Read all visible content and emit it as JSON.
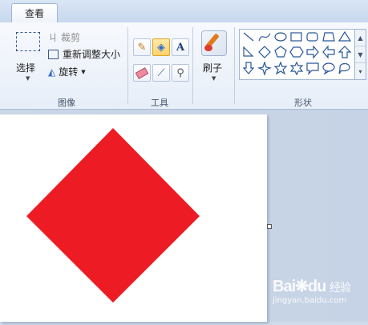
{
  "tabs": {
    "view": "查看"
  },
  "image_group": {
    "label": "图像",
    "select_label": "选择",
    "crop_label": "裁剪",
    "resize_label": "重新调整大小",
    "rotate_label": "旋转"
  },
  "tools_group": {
    "label": "工具",
    "text_tool": "A"
  },
  "brushes": {
    "label": "刷子"
  },
  "shapes_group": {
    "label": "形状"
  },
  "canvas": {
    "shape_color": "#ed1c24"
  },
  "watermark": {
    "line1": "Bai",
    "line2": "du",
    "line3": "经验",
    "line4": "jingyan.baidu.com"
  }
}
